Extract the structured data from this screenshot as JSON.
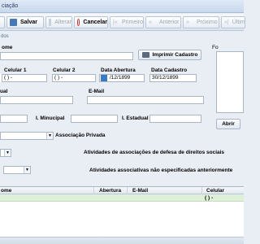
{
  "window": {
    "title": "ciação"
  },
  "toolbar": {
    "salvar": "Salvar",
    "alterar": "Alterar",
    "cancelar": "Cancelar",
    "primeiro": "Primeiro",
    "anterior": "Anterior",
    "proximo": "Próximo",
    "ultimo": "Últim"
  },
  "tab": {
    "label": "dos"
  },
  "form": {
    "nome_label": "ome",
    "imprimir_cadastro": "Imprimir Cadastro",
    "celular1_label": "Celular 1",
    "celular1_value": "(  )  -",
    "celular2_label": "Celular 2",
    "celular2_value": "(  )  -",
    "data_abertura_label": "Data Abertura",
    "data_abertura_value": "/12/1899",
    "data_cadastro_label": "Data Cadastro",
    "data_cadastro_value": "30/12/1899",
    "cut_field_value": "(  )",
    "ual_label": "ual",
    "email_label": "E-Mail",
    "inscricao_municipal_label": "I. Minucipal",
    "inscricao_estadual_label": "I. Estadual",
    "abrir_button": "Abrir",
    "associacao_privada": "Associação Privada",
    "atividades_defesa": "Atividades de associações de defesa de direitos sociais",
    "atividades_nao_especificadas": "Atividades associativas não especificadas anteriormente",
    "photo_label": "Fo"
  },
  "grid": {
    "columns": [
      "ome",
      "Abertura",
      "E-Mail",
      "Celular"
    ],
    "row": {
      "celular": "(  )  -"
    }
  }
}
